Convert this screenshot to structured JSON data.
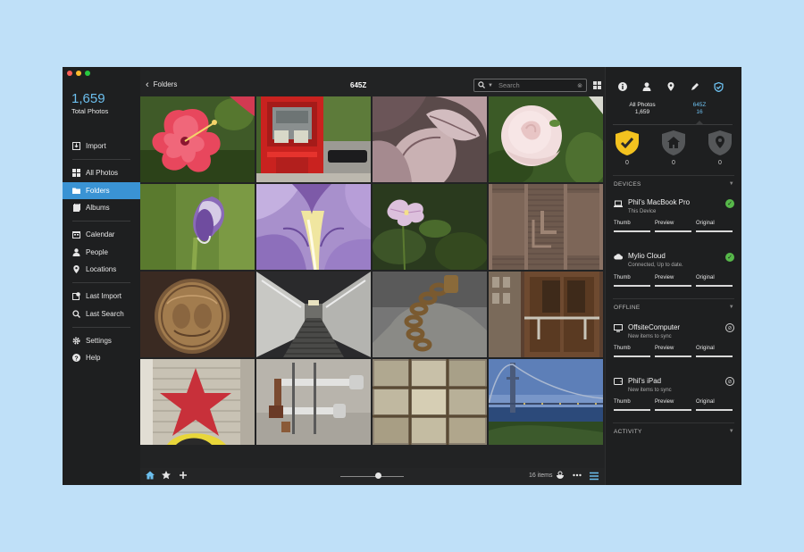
{
  "sidebar": {
    "total_count": "1,659",
    "total_label": "Total Photos",
    "items": [
      {
        "label": "Import",
        "icon": "import-icon"
      },
      {
        "label": "All Photos",
        "icon": "grid-icon"
      },
      {
        "label": "Folders",
        "icon": "folder-icon",
        "active": true
      },
      {
        "label": "Albums",
        "icon": "album-icon"
      },
      {
        "label": "Calendar",
        "icon": "calendar-icon"
      },
      {
        "label": "People",
        "icon": "person-icon"
      },
      {
        "label": "Locations",
        "icon": "pin-icon"
      },
      {
        "label": "Last Import",
        "icon": "last-import-icon"
      },
      {
        "label": "Last Search",
        "icon": "search-icon"
      },
      {
        "label": "Settings",
        "icon": "gear-icon"
      },
      {
        "label": "Help",
        "icon": "help-icon"
      }
    ]
  },
  "topbar": {
    "back_label": "Folders",
    "title": "645Z",
    "search_placeholder": "Search"
  },
  "photos": [
    "hibiscus",
    "red-call-box",
    "variegated-leaves",
    "white-rose",
    "purple-bud",
    "purple-iris",
    "pink-flower",
    "brick-wall",
    "bronze-medallion",
    "escalator",
    "chain-lock",
    "wooden-door",
    "star-graffiti",
    "industrial-pipes",
    "glass-blocks",
    "suspension-bridge"
  ],
  "bottombar": {
    "items_count": "16 items",
    "zoom_level": 0.6
  },
  "panel": {
    "columns": [
      {
        "label": "All Photos",
        "count": "1,659"
      },
      {
        "label": "645Z",
        "count": "16"
      }
    ],
    "shields": [
      {
        "type": "protected",
        "count": "0",
        "color": "#f3c21f"
      },
      {
        "type": "home",
        "count": "0",
        "color": "#555759"
      },
      {
        "type": "location",
        "count": "0",
        "color": "#555759"
      }
    ],
    "devices_header": "DEVICES",
    "offline_header": "OFFLINE",
    "activity_header": "ACTIVITY",
    "tiers": [
      "Thumb",
      "Preview",
      "Original"
    ],
    "devices": [
      {
        "name": "Phil's MacBook Pro",
        "sub": "This Device",
        "icon": "laptop-icon",
        "status": "ok"
      },
      {
        "name": "Mylio Cloud",
        "sub": "Connected, Up to date.",
        "icon": "cloud-icon",
        "status": "ok"
      }
    ],
    "offline": [
      {
        "name": "OffsiteComputer",
        "sub": "New items to sync",
        "icon": "monitor-icon",
        "status": "offline"
      },
      {
        "name": "Phil's iPad",
        "sub": "New items to sync",
        "icon": "tablet-icon",
        "status": "offline"
      }
    ]
  }
}
